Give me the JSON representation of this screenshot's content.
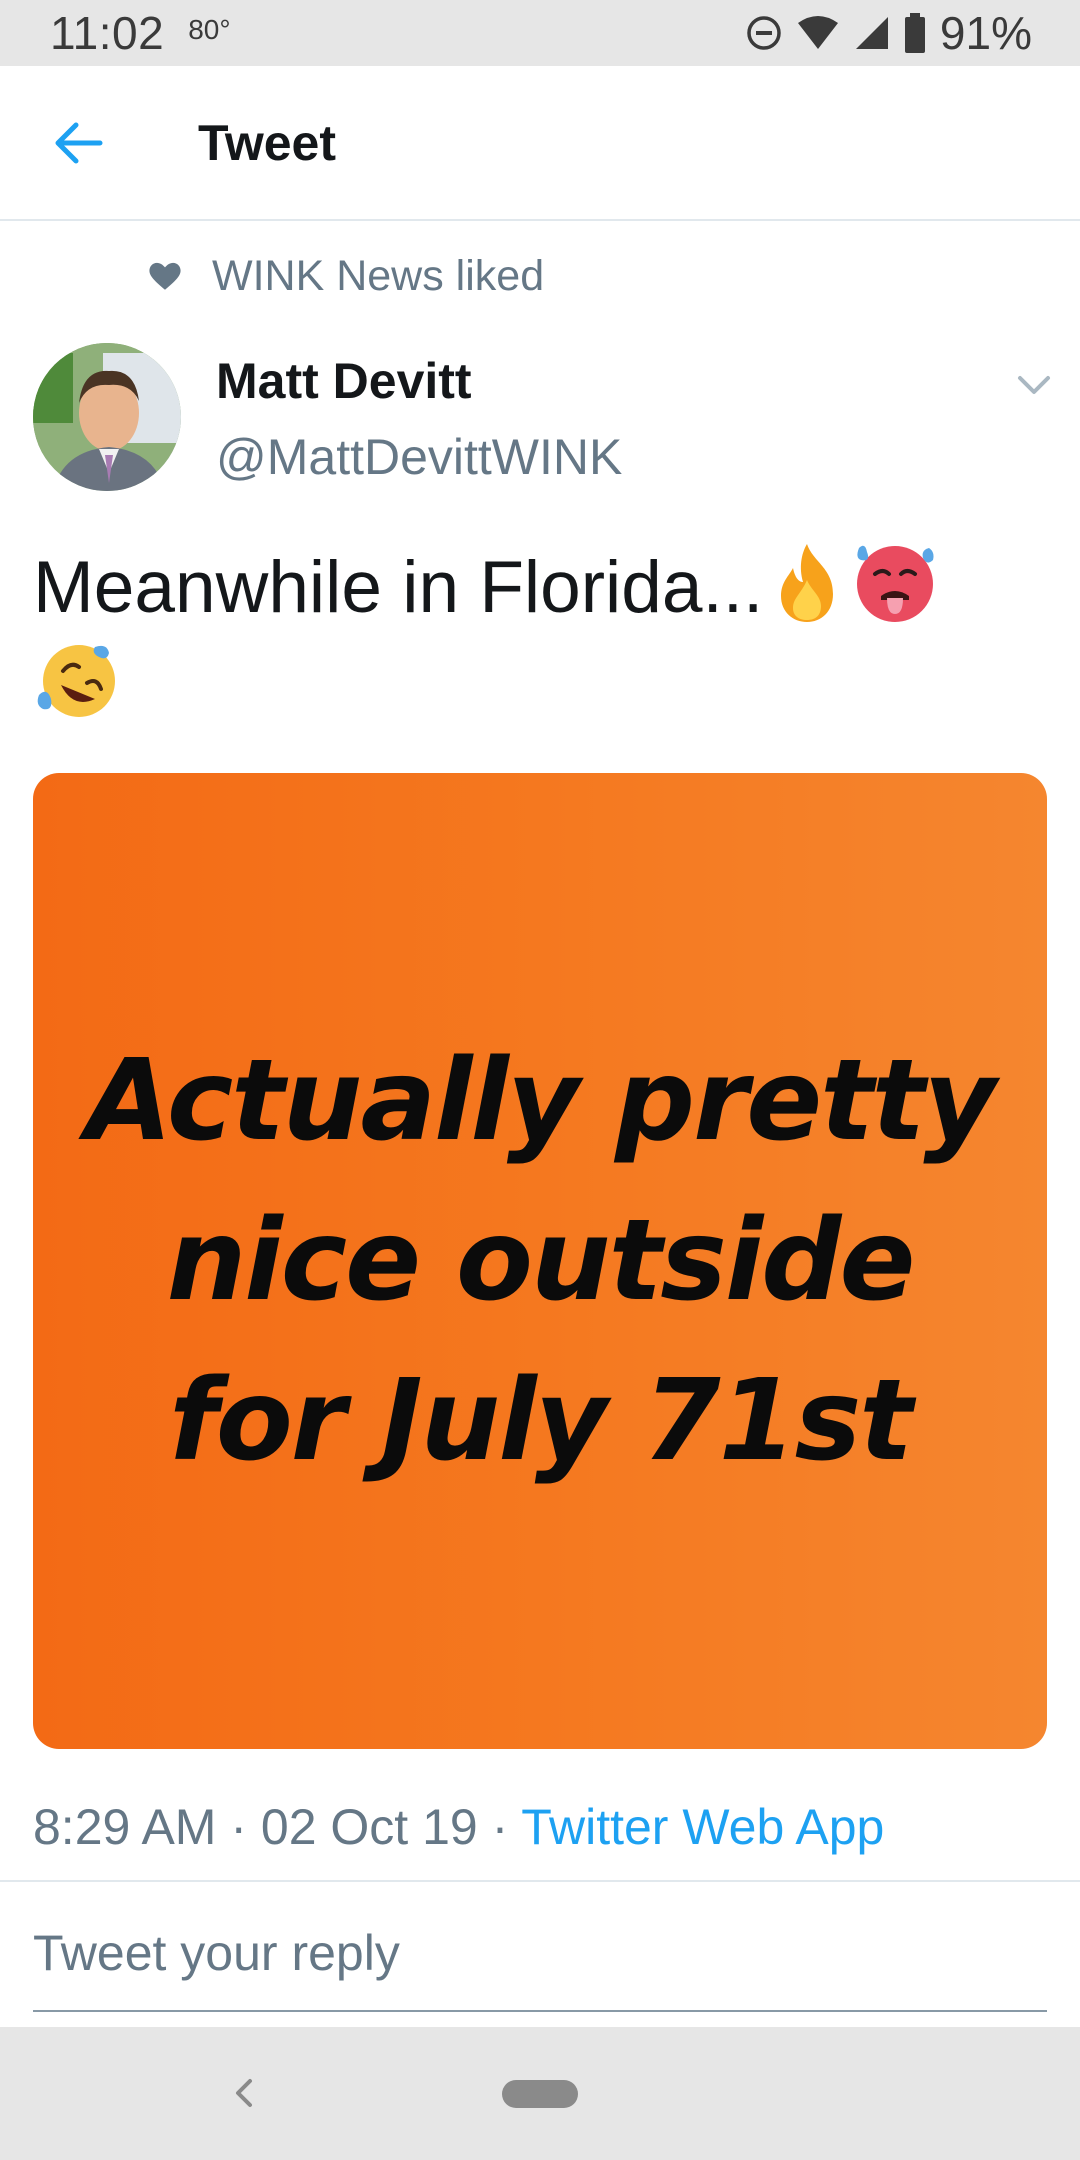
{
  "status_bar": {
    "time": "11:02",
    "temperature": "80°",
    "battery": "91%",
    "icons": [
      "do-not-disturb-icon",
      "wifi-icon",
      "cell-signal-icon",
      "battery-icon"
    ]
  },
  "app_bar": {
    "title": "Tweet",
    "back_icon": "arrow-left-icon"
  },
  "social_context": {
    "text": "WINK News liked",
    "icon": "heart-icon"
  },
  "tweet": {
    "author_name": "Matt Devitt",
    "author_handle": "@MattDevittWINK",
    "text": "Meanwhile in Florida...",
    "emojis": [
      "fire-emoji",
      "hot-face-emoji",
      "rolling-laughing-emoji"
    ],
    "image_text_lines": [
      "Actually pretty",
      "nice outside",
      "for July 71st"
    ],
    "time": "8:29 AM",
    "date": "02 Oct 19",
    "separator": " · ",
    "source": "Twitter Web App"
  },
  "reply": {
    "placeholder": "Tweet your reply"
  },
  "colors": {
    "accent": "#1da1f2",
    "secondary_text": "#657786",
    "image_bg": "#f36a15"
  }
}
